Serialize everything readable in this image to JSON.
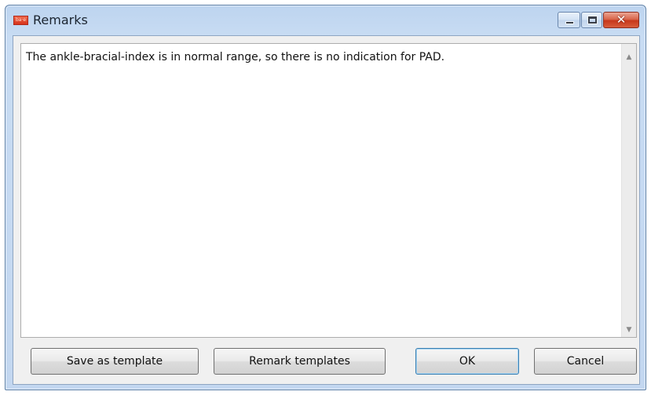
{
  "window": {
    "title": "Remarks",
    "app_icon_text": "ba·e",
    "minimize_glyph": "minimize-icon",
    "maximize_glyph": "maximize-icon",
    "close_glyph": "✕"
  },
  "remarks": {
    "text": "The ankle-bracial-index is in normal range, so there is no indication for PAD.",
    "scroll_up": "▲",
    "scroll_down": "▼"
  },
  "buttons": {
    "save_as_template": "Save as template",
    "remark_templates": "Remark templates",
    "ok": "OK",
    "cancel": "Cancel"
  },
  "colors": {
    "title_bar": "#c8dcf3",
    "close_button": "#c7381b",
    "dialog_body": "#f0f0f0",
    "default_button_border": "#3c7fb1"
  }
}
